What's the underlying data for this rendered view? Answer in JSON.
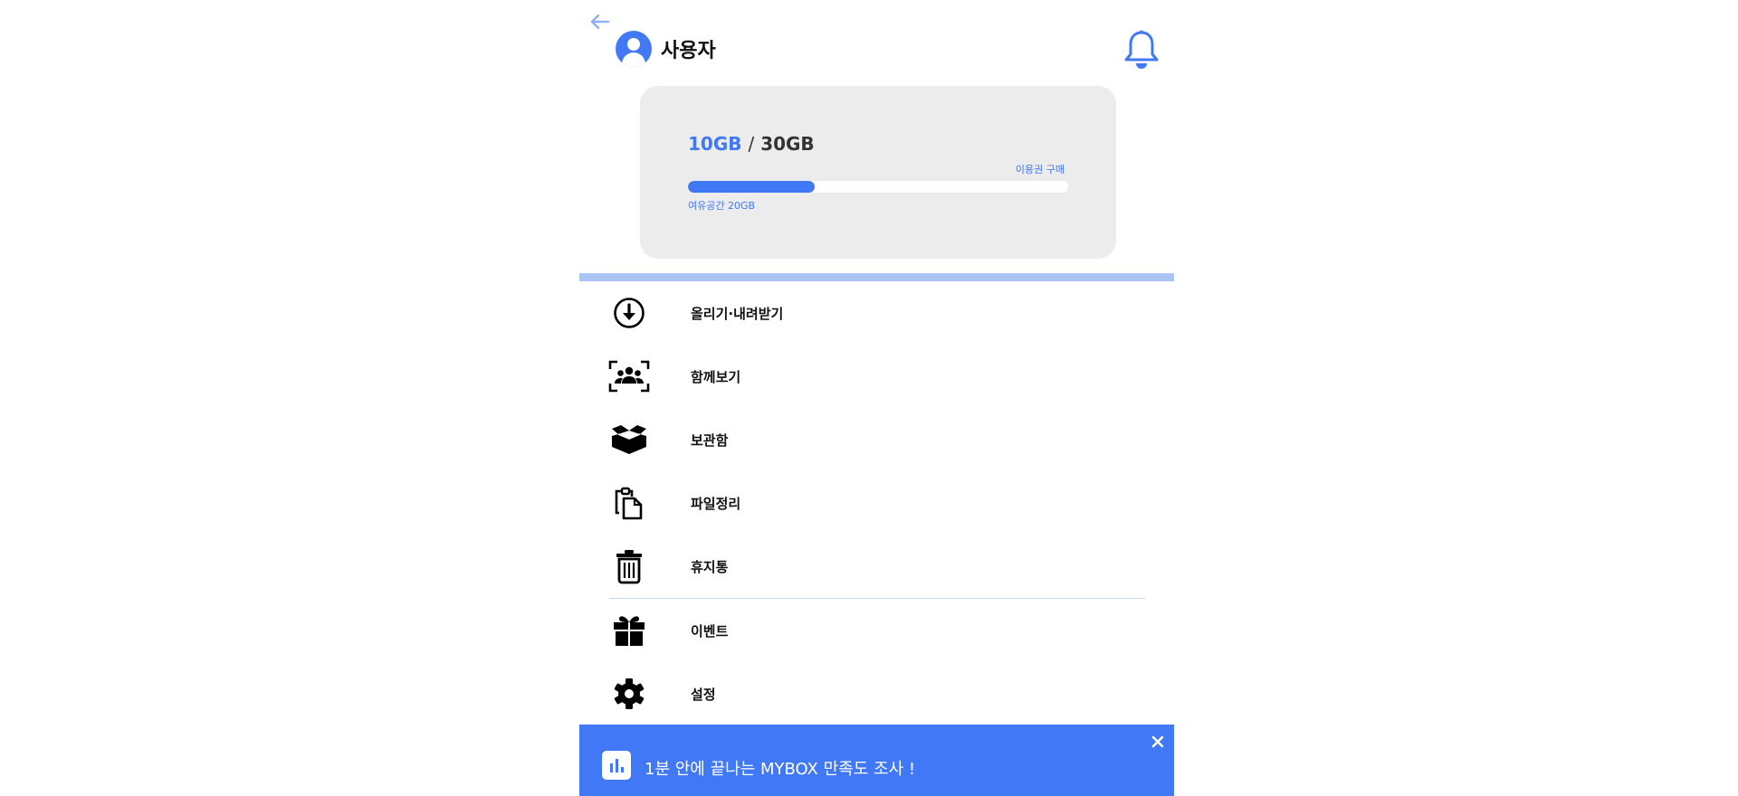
{
  "header": {
    "back_icon": "arrow-left-icon",
    "user_icon": "user-avatar-icon",
    "user_name": "사용자",
    "bell_icon": "bell-icon"
  },
  "storage": {
    "used": "10GB",
    "separator": "/",
    "total": "30GB",
    "buy_label": "이용권 구매",
    "free_label": "여유공간 20GB",
    "used_fraction": 0.333
  },
  "menu": {
    "items": [
      {
        "label": "올리기·내려받기",
        "icon": "download-circle-icon"
      },
      {
        "label": "함께보기",
        "icon": "group-scan-icon"
      },
      {
        "label": "보관함",
        "icon": "open-box-icon"
      },
      {
        "label": "파일정리",
        "icon": "clipboard-files-icon"
      },
      {
        "label": "휴지통",
        "icon": "trash-icon"
      },
      {
        "label": "이벤트",
        "icon": "gift-icon"
      },
      {
        "label": "설정",
        "icon": "gear-icon"
      }
    ]
  },
  "banner": {
    "icon": "bar-chart-icon",
    "text": "1분 안에 끝나는 MYBOX 만족도 조사 !",
    "close_icon": "close-icon"
  },
  "colors": {
    "accent": "#4178f5",
    "card_bg": "#ececec",
    "band": "#abc4f6"
  }
}
